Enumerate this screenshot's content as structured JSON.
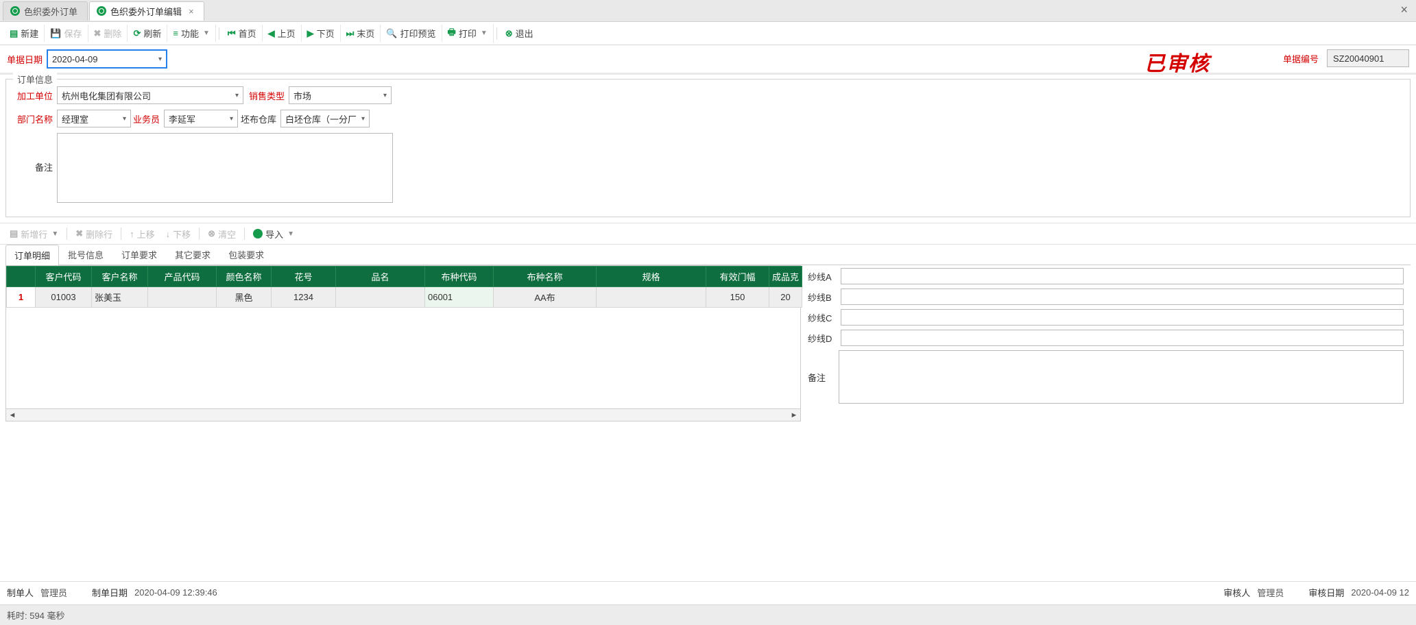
{
  "tabs": [
    {
      "label": "色织委外订单"
    },
    {
      "label": "色织委外订单编辑"
    }
  ],
  "toolbar": {
    "new_": "新建",
    "save": "保存",
    "delete_": "删除",
    "refresh": "刷新",
    "function_": "功能",
    "first": "首页",
    "prev": "上页",
    "next": "下页",
    "last": "末页",
    "print_preview": "打印预览",
    "print": "打印",
    "exit": "退出"
  },
  "header": {
    "bill_date_label": "单据日期",
    "bill_date_value": "2020-04-09",
    "audit_stamp": "已审核",
    "docno_label": "单据编号",
    "docno_value": "SZ20040901"
  },
  "orderinfo": {
    "legend": "订单信息",
    "process_unit_label": "加工单位",
    "process_unit_value": "杭州电化集团有限公司",
    "sale_type_label": "销售类型",
    "sale_type_value": "市场",
    "dept_label": "部门名称",
    "dept_value": "经理室",
    "salesman_label": "业务员",
    "salesman_value": "李延军",
    "greystock_label": "坯布仓库",
    "greystock_value": "白坯仓库（一分厂",
    "remark_label": "备注",
    "remark_value": ""
  },
  "grid_toolbar": {
    "addrow": "新增行",
    "delrow": "删除行",
    "moveup": "上移",
    "movedown": "下移",
    "clear": "清空",
    "import": "导入"
  },
  "detail_tabs": [
    "订单明细",
    "批号信息",
    "订单要求",
    "其它要求",
    "包装要求"
  ],
  "grid": {
    "columns": [
      "",
      "客户代码",
      "客户名称",
      "产品代码",
      "颜色名称",
      "花号",
      "品名",
      "布种代码",
      "布种名称",
      "规格",
      "有效门幅",
      "成品克"
    ],
    "rows": [
      {
        "rownum": "1",
        "customer_code": "01003",
        "customer_name": "张美玉",
        "product_code": "",
        "color_name": "黑色",
        "pattern_no": "1234",
        "product_name": "",
        "fabric_code": "06001",
        "fabric_name": "AA布",
        "spec": "",
        "valid_width": "150",
        "finished_weight": "20"
      }
    ]
  },
  "sidepanel": {
    "yarnA_label": "纱线A",
    "yarnA_value": "",
    "yarnB_label": "纱线B",
    "yarnB_value": "",
    "yarnC_label": "纱线C",
    "yarnC_value": "",
    "yarnD_label": "纱线D",
    "yarnD_value": "",
    "remark_label": "备注",
    "remark_value": ""
  },
  "footer": {
    "maker_label": "制单人",
    "maker_value": "管理员",
    "make_date_label": "制单日期",
    "make_date_value": "2020-04-09 12:39:46",
    "auditor_label": "审核人",
    "auditor_value": "管理员",
    "audit_date_label": "审核日期",
    "audit_date_value": "2020-04-09 12"
  },
  "statusbar": {
    "text": "耗时: 594 毫秒"
  }
}
